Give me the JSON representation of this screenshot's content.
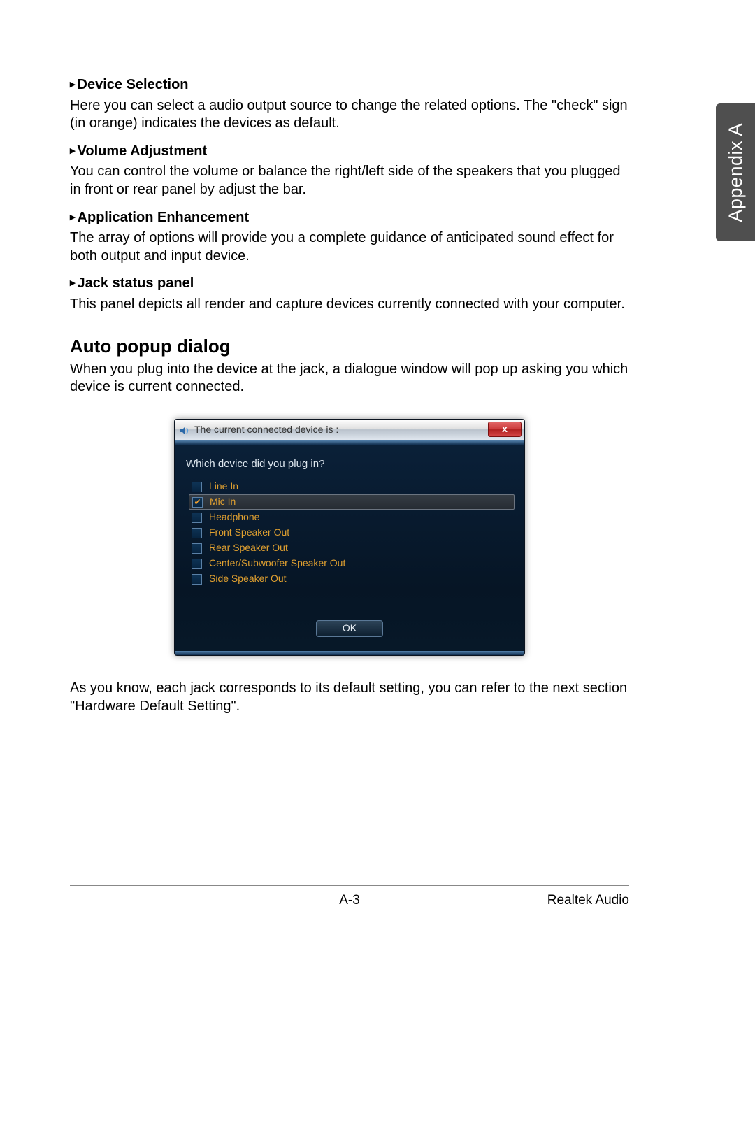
{
  "sideTab": "Appendix A",
  "sections": [
    {
      "title": "Device Selection",
      "body": "Here you can select a audio output source to change the related options. The \"check\" sign (in orange) indicates the devices as default."
    },
    {
      "title": "Volume Adjustment",
      "body": "You can control the volume or balance the right/left side of the speakers that you plugged in front or rear panel by adjust the bar."
    },
    {
      "title": "Application Enhancement",
      "body": "The array of options will provide you a complete guidance of anticipated sound effect for both output and input device."
    },
    {
      "title": "Jack status panel",
      "body": "This panel depicts all render and capture devices currently connected with your computer."
    }
  ],
  "heading2": "Auto popup dialog",
  "heading2_body": "When you plug into the device at the jack, a dialogue window will pop up asking you which device is current connected.",
  "dialog": {
    "title": "The current connected device is :",
    "close": "x",
    "prompt": "Which device did you plug in?",
    "devices": [
      {
        "label": "Line In",
        "checked": false,
        "selected": false
      },
      {
        "label": "Mic In",
        "checked": true,
        "selected": true
      },
      {
        "label": "Headphone",
        "checked": false,
        "selected": false
      },
      {
        "label": "Front Speaker Out",
        "checked": false,
        "selected": false
      },
      {
        "label": "Rear Speaker Out",
        "checked": false,
        "selected": false
      },
      {
        "label": "Center/Subwoofer Speaker Out",
        "checked": false,
        "selected": false
      },
      {
        "label": "Side Speaker Out",
        "checked": false,
        "selected": false
      }
    ],
    "ok": "OK"
  },
  "afterDialog": "As you know, each jack corresponds to its default setting, you can refer to the next section \"Hardware Default Setting\".",
  "footer": {
    "page": "A-3",
    "right": "Realtek Audio"
  }
}
